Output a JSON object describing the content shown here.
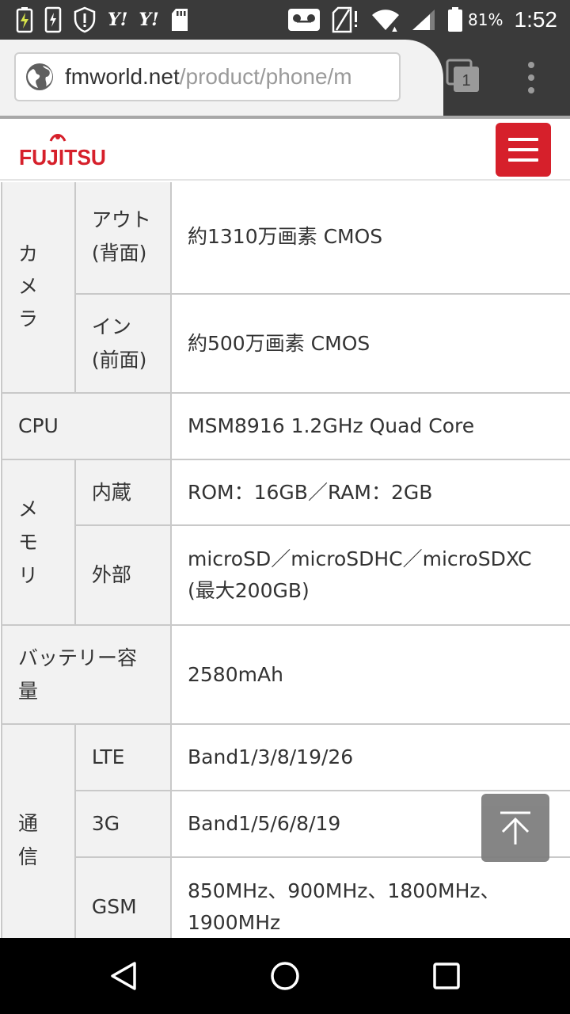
{
  "status_bar": {
    "battery_percent": "81%",
    "time": "1:52",
    "icons": [
      "battery-charging-icon",
      "phone-charging-icon",
      "shield-alert-icon",
      "yahoo-icon",
      "yahoo-icon",
      "sd-card-icon",
      "voicemail-icon",
      "no-sim-icon",
      "wifi-icon",
      "signal-icon",
      "battery-icon"
    ],
    "yahoo_label": "Y!"
  },
  "browser": {
    "url_host": "fmworld.net",
    "url_path": "/product/phone/m",
    "tab_count": "1",
    "menu_icon": "more-vert-icon"
  },
  "site": {
    "logo_text": "FUJITSU",
    "menu_icon": "hamburger-icon",
    "brand_color": "#d6202b"
  },
  "spec_table": {
    "camera": {
      "label": "カメラ",
      "rows": [
        {
          "sub": "アウト(背面)",
          "value": "約1310万画素 CMOS"
        },
        {
          "sub": "イン(前面)",
          "value": "約500万画素 CMOS"
        }
      ]
    },
    "cpu": {
      "label": "CPU",
      "value": "MSM8916 1.2GHz Quad Core"
    },
    "memory": {
      "label": "メモリ",
      "rows": [
        {
          "sub": "内蔵",
          "value": "ROM：16GB／RAM：2GB"
        },
        {
          "sub": "外部",
          "value": "microSD／microSDHC／microSDXC(最大200GB)"
        }
      ]
    },
    "battery": {
      "label": "バッテリー容量",
      "value": "2580mAh"
    },
    "comm": {
      "label": "通信",
      "rows": [
        {
          "sub": "LTE",
          "value": "Band1/3/8/19/26"
        },
        {
          "sub": "3G",
          "value": "Band1/5/6/8/19"
        },
        {
          "sub": "GSM",
          "value": "850MHz、900MHz、1800MHz、1900MHz"
        }
      ]
    }
  },
  "back_to_top_icon": "arrow-up-to-top-icon",
  "nav_bar": {
    "back_icon": "back-triangle-icon",
    "home_icon": "home-circle-icon",
    "recents_icon": "recents-square-icon"
  }
}
